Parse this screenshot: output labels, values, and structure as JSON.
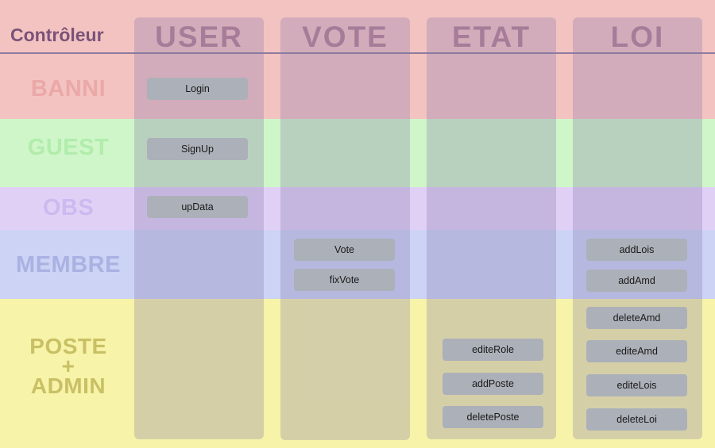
{
  "header": {
    "controller_label": "Contrôleur"
  },
  "columns": {
    "user": "USER",
    "vote": "VOTE",
    "etat": "ETAT",
    "loi": "LOI"
  },
  "rows": {
    "banni": "BANNI",
    "guest": "GUEST",
    "obs": "OBS",
    "membre": "MEMBRE",
    "admin_line1": "POSTE",
    "admin_line2": "+",
    "admin_line3": "ADMIN"
  },
  "functions": {
    "user": [
      "Login",
      "SignUp",
      "upData"
    ],
    "vote": [
      "Vote",
      "fixVote"
    ],
    "etat": [
      "editeRole",
      "addPoste",
      "deletePoste"
    ],
    "loi": [
      "addLois",
      "addAmd",
      "deleteAmd",
      "editeAmd",
      "editeLois",
      "deleteLoi"
    ]
  },
  "colors": {
    "banni": "#f3c3c1",
    "guest": "#cff6c8",
    "obs": "#e1d0f6",
    "membre": "#cdd3f5",
    "admin": "#f7f3a8",
    "function_box": "#acb0b8"
  }
}
